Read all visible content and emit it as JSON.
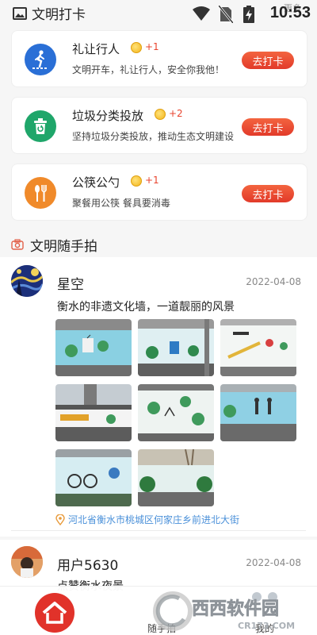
{
  "status_bar": {
    "time": "10:53"
  },
  "header": {
    "title": "文明打卡",
    "more": "更多"
  },
  "tasks": [
    {
      "title": "礼让行人",
      "points": "+1",
      "desc": "文明开车，礼让行人，安全你我他！",
      "button": "去打卡",
      "icon": "pedestrian-crossing-icon",
      "color": "#2a6fd6"
    },
    {
      "title": "垃圾分类投放",
      "points": "+2",
      "desc": "坚持垃圾分类投放，推动生态文明建设",
      "button": "去打卡",
      "icon": "trash-bin-icon",
      "color": "#1fa66a"
    },
    {
      "title": "公筷公勺",
      "points": "+1",
      "desc": "聚餐用公筷 餐具要消毒",
      "button": "去打卡",
      "icon": "spoon-fork-icon",
      "color": "#f08a2a"
    }
  ],
  "photos_section": {
    "title": "文明随手拍"
  },
  "posts": [
    {
      "username": "星空",
      "date": "2022-04-08",
      "text": "衡水的非遗文化墙，一道靓丽的风景",
      "location": "河北省衡水市桃城区何家庄乡前进北大街"
    },
    {
      "username": "用户5630",
      "date": "2022-04-08",
      "text": "点赞衡水夜景"
    }
  ],
  "bottom_nav": {
    "home": "首页",
    "snap": "随手拍",
    "mine": "我的"
  },
  "watermark": {
    "text": "西西软件园",
    "url": "CR173.COM"
  },
  "colors": {
    "accent": "#e23a2a",
    "link": "#4a90d9"
  }
}
